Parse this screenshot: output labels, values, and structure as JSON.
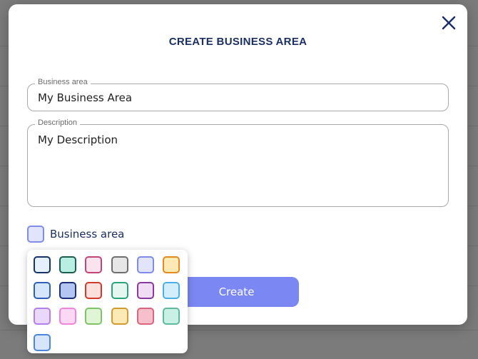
{
  "dialog": {
    "title": "CREATE BUSINESS AREA",
    "close_icon": "close-icon"
  },
  "fields": {
    "business_area": {
      "label": "Business area",
      "value": "My Business Area"
    },
    "description": {
      "label": "Description",
      "value": "My Description"
    }
  },
  "color_picker": {
    "label": "Business area",
    "selected": {
      "fill": "#e2e4fb",
      "border": "#7f8be8"
    },
    "swatches": [
      {
        "fill": "#e6f0fb",
        "border": "#17336b"
      },
      {
        "fill": "#b9eee3",
        "border": "#1d5e52"
      },
      {
        "fill": "#fbe3ee",
        "border": "#c2457a"
      },
      {
        "fill": "#e6e6e6",
        "border": "#6e6e6e"
      },
      {
        "fill": "#e2e4fb",
        "border": "#7f8be8"
      },
      {
        "fill": "#fde9b3",
        "border": "#e68a1d"
      },
      {
        "fill": "#d6e6fa",
        "border": "#2f5fb8"
      },
      {
        "fill": "#b5c5f2",
        "border": "#1c2f7a"
      },
      {
        "fill": "#fce0dc",
        "border": "#d23a2a"
      },
      {
        "fill": "#e4f6ef",
        "border": "#2aa378"
      },
      {
        "fill": "#f1dcf5",
        "border": "#8a3a9e"
      },
      {
        "fill": "#d3eefb",
        "border": "#4cb0e6"
      },
      {
        "fill": "#ead8fb",
        "border": "#b57ef0"
      },
      {
        "fill": "#fcd8f5",
        "border": "#ef84dc"
      },
      {
        "fill": "#dff5d6",
        "border": "#7dc467"
      },
      {
        "fill": "#fde9b6",
        "border": "#d39a30"
      },
      {
        "fill": "#f7bfcc",
        "border": "#d9667d"
      },
      {
        "fill": "#c9f0e5",
        "border": "#5fb8a0"
      },
      {
        "fill": "#d6e6fa",
        "border": "#4a86e0"
      }
    ]
  },
  "actions": {
    "create_label": "Create"
  }
}
